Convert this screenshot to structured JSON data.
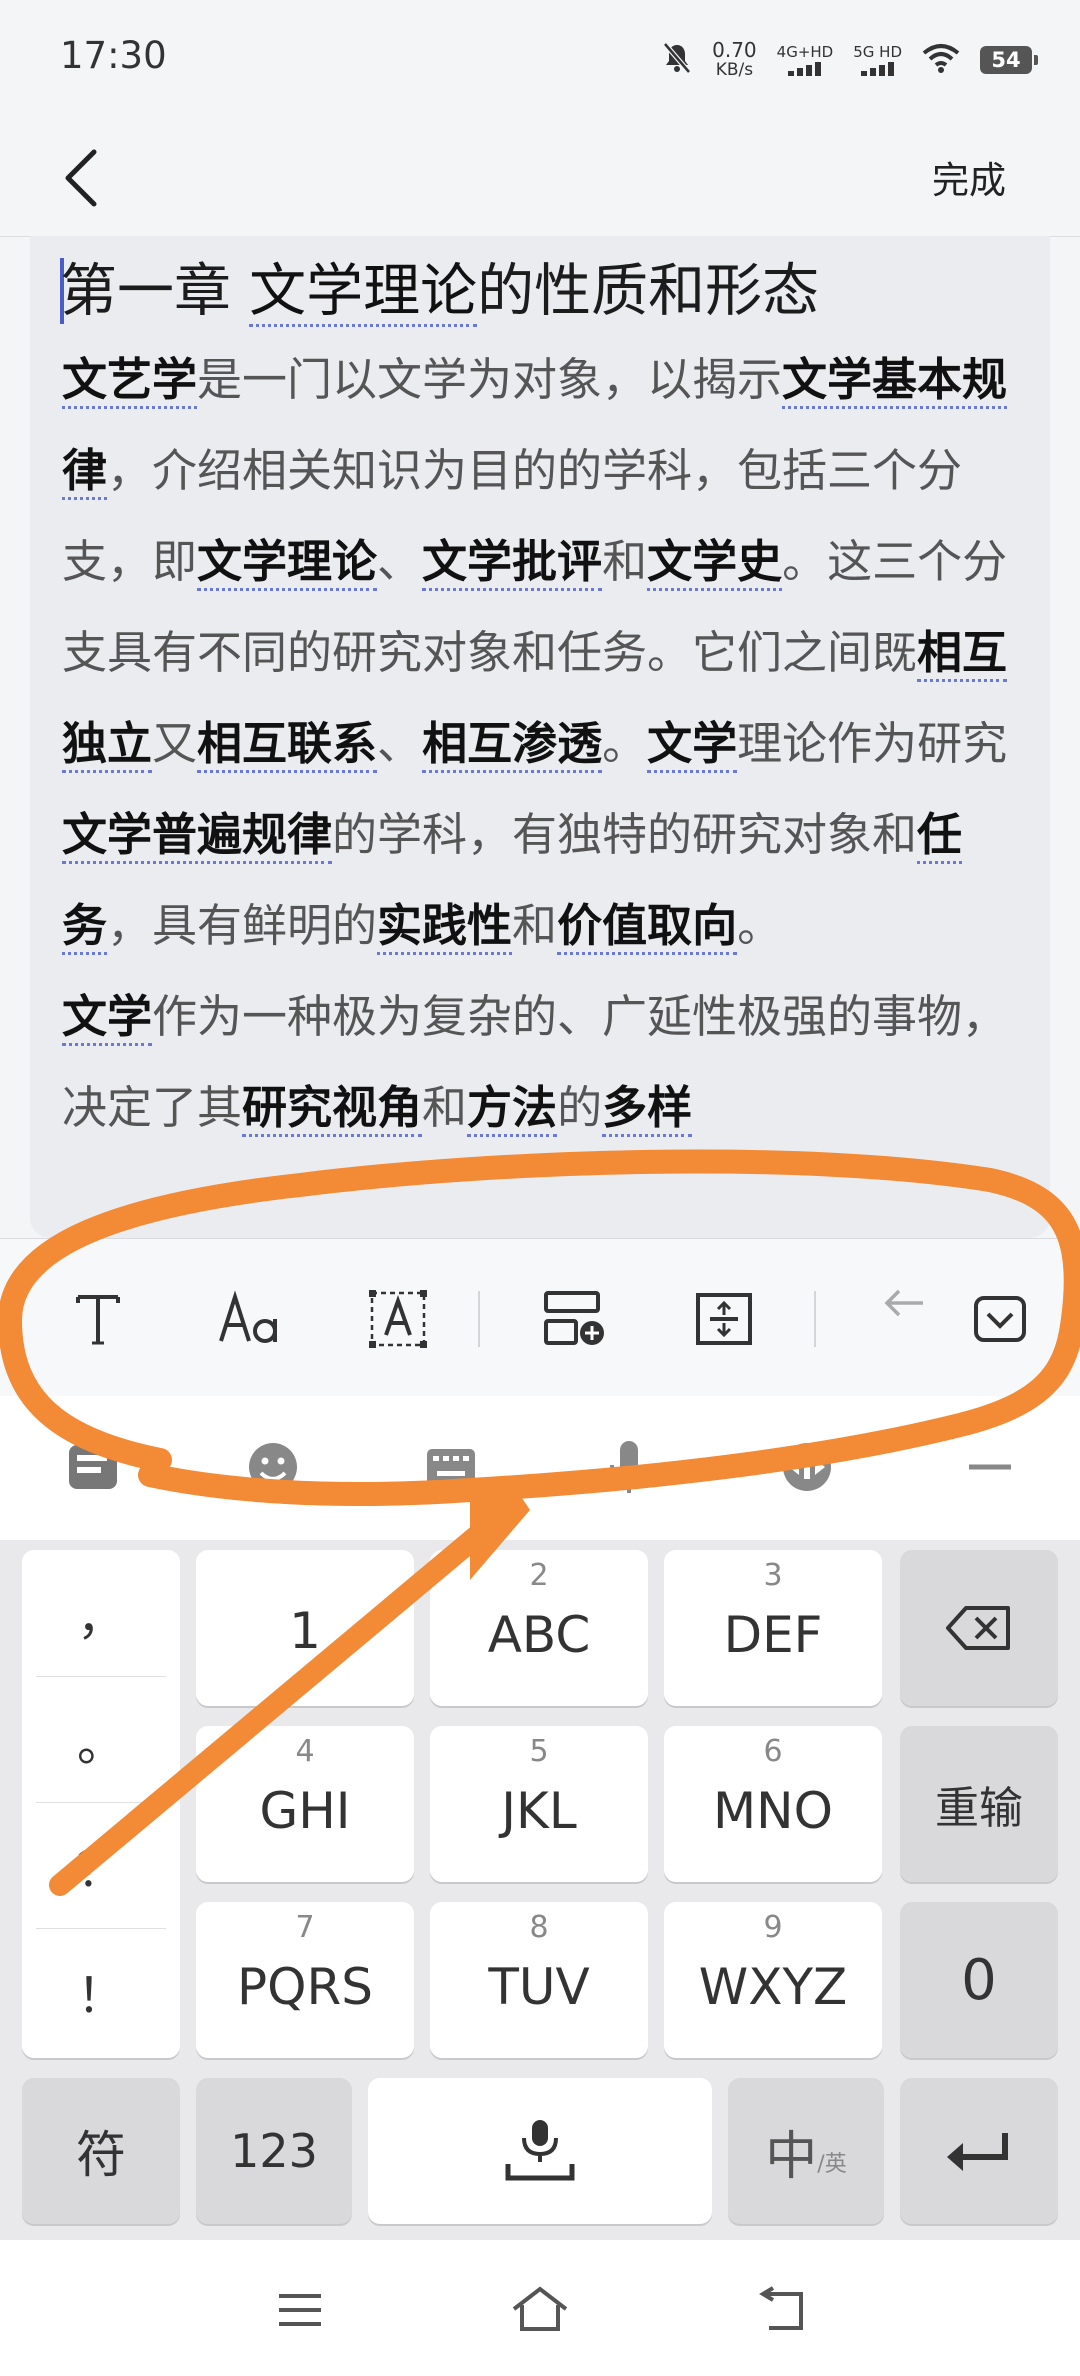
{
  "status_bar": {
    "time": "17:30",
    "net_speed_value": "0.70",
    "net_speed_unit": "KB/s",
    "network_1": "4G+HD",
    "network_2": "5G HD",
    "battery": "54",
    "icons": [
      "mute-bell-icon",
      "signal-icon",
      "wifi-icon",
      "battery-icon"
    ]
  },
  "nav": {
    "back_icon": "back-chevron-icon",
    "done_label": "完成"
  },
  "document": {
    "title_prefix": "第一章 ",
    "title_term": "文学理论",
    "title_suffix": "的性质和形态",
    "p1": {
      "t1": "文艺学",
      "t2": "是一门以文学为对象，以揭示",
      "t3": "文学基本规律",
      "t4": "，介绍相关知识为目的的学科，包括三个分支，即",
      "t5": "文学理论",
      "t6": "、",
      "t7": "文学批评",
      "t8": "和",
      "t9": "文学史",
      "t10": "。这三个分支具有不同的研究对象和任务。它们之间既",
      "t11": "相互独立",
      "t12": "又",
      "t13": "相互联系",
      "t14": "、",
      "t15": "相互渗透",
      "t16": "。",
      "t17": "文学",
      "t18": "理论作为研究",
      "t19": "文学普遍规律",
      "t20": "的学科，有独特的研究对象和",
      "t21": "任务",
      "t22": "，具有鲜明的",
      "t23": "实践性",
      "t24": "和",
      "t25": "价值取向",
      "t26": "。"
    },
    "p2": {
      "t1": "文学",
      "t2": "作为一种极为复杂的、广延性极强的事物，决定了其",
      "t3": "研究视角",
      "t4": "和",
      "t5": "方法",
      "t6": "的",
      "t7": "多样"
    }
  },
  "format_toolbar": {
    "icons": [
      "text-style-icon",
      "font-size-icon",
      "text-box-icon",
      "insert-block-icon",
      "line-spacing-icon",
      "undo-icon",
      "collapse-keyboard-icon"
    ]
  },
  "ime_toolbar": {
    "icons": [
      "ime-logo-icon",
      "emoji-icon",
      "keyboard-icon",
      "voice-icon",
      "cursor-move-icon",
      "more-icon"
    ]
  },
  "keyboard": {
    "punctuation": [
      "，",
      "。",
      "？",
      "！"
    ],
    "keys": [
      {
        "num": "",
        "main": "1"
      },
      {
        "num": "2",
        "main": "ABC"
      },
      {
        "num": "3",
        "main": "DEF"
      },
      {
        "num": "4",
        "main": "GHI"
      },
      {
        "num": "5",
        "main": "JKL"
      },
      {
        "num": "6",
        "main": "MNO"
      },
      {
        "num": "7",
        "main": "PQRS"
      },
      {
        "num": "8",
        "main": "TUV"
      },
      {
        "num": "9",
        "main": "WXYZ"
      }
    ],
    "reinput_label": "重输",
    "zero_label": "0",
    "symbol_label": "符",
    "num_label": "123",
    "lang_main": "中",
    "lang_sub": "/英",
    "icons": [
      "backspace-icon",
      "space-mic-icon",
      "enter-icon"
    ]
  },
  "system_nav": {
    "icons": [
      "menu-icon",
      "home-icon",
      "back-icon"
    ]
  },
  "annotation": {
    "color": "#F28A36"
  }
}
